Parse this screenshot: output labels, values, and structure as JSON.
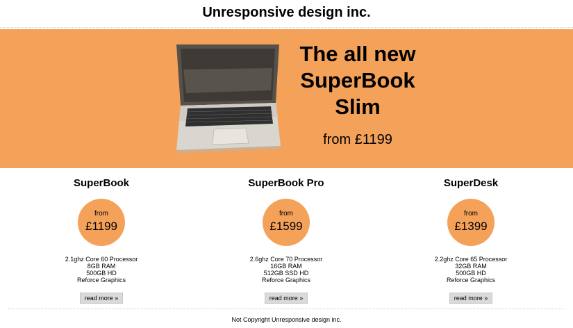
{
  "site": {
    "title": "Unresponsive design inc."
  },
  "hero": {
    "headline_lines": [
      "The all new",
      "SuperBook",
      "Slim"
    ],
    "price_text": "from £1199",
    "image": "laptop-image",
    "background_color": "#f4a25a"
  },
  "products": [
    {
      "name": "SuperBook",
      "price_from": "from",
      "price": "£1199",
      "specs": [
        "2.1ghz Core 60 Processor",
        "8GB RAM",
        "500GB HD",
        "Reforce Graphics"
      ],
      "button_label": "read more »"
    },
    {
      "name": "SuperBook Pro",
      "price_from": "from",
      "price": "£1599",
      "specs": [
        "2.6ghz Core 70 Processor",
        "16GB RAM",
        "512GB SSD HD",
        "Reforce Graphics"
      ],
      "button_label": "read more »"
    },
    {
      "name": "SuperDesk",
      "price_from": "from",
      "price": "£1399",
      "specs": [
        "2.2ghz Core 65 Processor",
        "32GB RAM",
        "500GB HD",
        "Reforce Graphics"
      ],
      "button_label": "read more »"
    }
  ],
  "footer": {
    "text": "Not Copyright Unresponsive design inc."
  }
}
